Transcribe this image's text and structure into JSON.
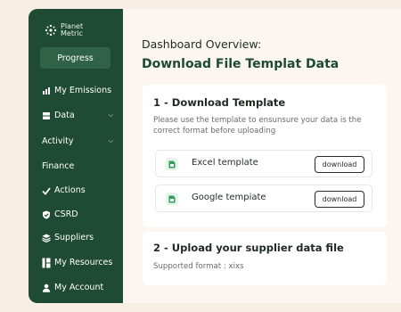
{
  "sidebar": {
    "logo_line1": "Planet",
    "logo_line2": "Metric",
    "progress_label": "Progress",
    "items": [
      {
        "label": "My Emissions",
        "icon": "bar-chart-icon"
      },
      {
        "label": "Data",
        "icon": "database-icon"
      },
      {
        "label": "Activity",
        "icon": ""
      },
      {
        "label": "Finance",
        "icon": ""
      },
      {
        "label": "Actions",
        "icon": "check-icon"
      },
      {
        "label": "CSRD",
        "icon": "shield-check-icon"
      },
      {
        "label": "Suppliers",
        "icon": "layers-icon"
      },
      {
        "label": "My Resources",
        "icon": "book-icon"
      },
      {
        "label": "My Account",
        "icon": "user-icon"
      }
    ]
  },
  "main": {
    "overview_title": "Dashboard Overview:",
    "page_title": "Download File Templat Data",
    "step1": {
      "title": "1 - Download Template",
      "description": "Please use the template to ensunsure your data is the correct format before uploading",
      "templates": [
        {
          "label": "Excel template",
          "button": "download"
        },
        {
          "label": "Google tempiate",
          "button": "download"
        }
      ]
    },
    "step2": {
      "title": "2 - Upload your supplier data file",
      "description": "Supported format : xixs"
    }
  },
  "colors": {
    "sidebar_bg": "#1f4a34",
    "accent": "#1e4a33",
    "background": "#f7efe3"
  }
}
